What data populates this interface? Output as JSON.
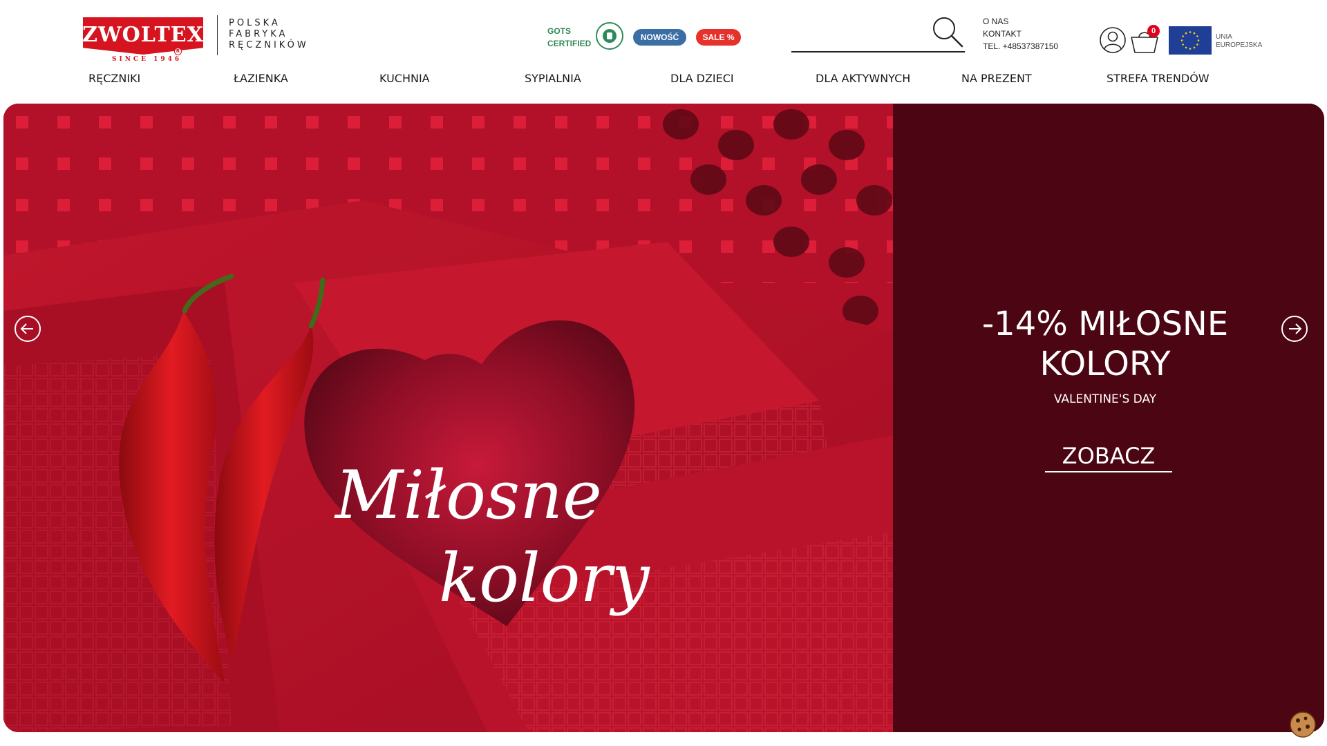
{
  "brand": {
    "name": "ZWOLTEX",
    "since": "SINCE 1946",
    "tagline_lines": [
      "POLSKA",
      "FABRYKA",
      "RĘCZNIKÓW"
    ]
  },
  "badges": {
    "gots_line1": "GOTS",
    "gots_line2": "CERTIFIED",
    "new_label": "NOWOŚĆ",
    "sale_label": "SALE %"
  },
  "search": {
    "placeholder": "",
    "value": ""
  },
  "top_links": {
    "about": "O NAS",
    "contact": "KONTAKT",
    "phone": "TEL. +48537387150"
  },
  "cart": {
    "count": "0"
  },
  "eu": {
    "line1": "UNIA",
    "line2": "EUROPEJSKA"
  },
  "nav": {
    "items": [
      {
        "label": "RĘCZNIKI"
      },
      {
        "label": "ŁAZIENKA"
      },
      {
        "label": "KUCHNIA"
      },
      {
        "label": "SYPIALNIA"
      },
      {
        "label": "DLA DZIECI"
      },
      {
        "label": "DLA AKTYWNYCH"
      },
      {
        "label": "NA PREZENT"
      },
      {
        "label": "STREFA TRENDÓW"
      }
    ]
  },
  "hero": {
    "image_script_line1": "Miłosne",
    "image_script_line2": "kolory",
    "title_line1": "-14% MIŁOSNE",
    "title_line2": "KOLORY",
    "subtitle": "VALENTINE'S DAY",
    "cta": "ZOBACZ"
  },
  "colors": {
    "brand_red": "#d5141f",
    "panel": "#4c0512",
    "new_pill": "#3c6ea6",
    "sale_pill": "#e5322b",
    "gots_green": "#2e8b57",
    "eu_blue": "#1f3f96"
  },
  "icons": {
    "search": "search-icon",
    "user": "user-icon",
    "cart": "cart-icon",
    "arrow_left": "arrow-left-icon",
    "arrow_right": "arrow-right-icon",
    "cookie": "cookie-icon"
  }
}
